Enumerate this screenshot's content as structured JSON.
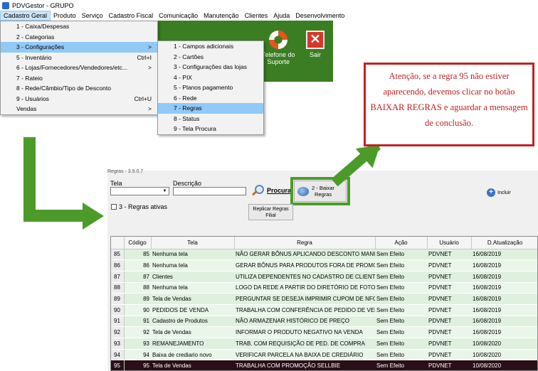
{
  "window": {
    "title": "PDVGestor - GRUPO"
  },
  "menubar": [
    "Cadastro Geral",
    "Produto",
    "Serviço",
    "Cadastro Fiscal",
    "Comunicação",
    "Manutenção",
    "Clientes",
    "Ajuda",
    "Desenvolvimento"
  ],
  "main_menu": [
    {
      "label": "1 - Caixa/Despesas",
      "shortcut": "",
      "arrow": false
    },
    {
      "label": "2 - Categorias",
      "shortcut": "",
      "arrow": false
    },
    {
      "label": "3 - Configurações",
      "shortcut": "",
      "arrow": true,
      "selected": true
    },
    {
      "label": "5 - Inventário",
      "shortcut": "Ctrl+I",
      "arrow": false
    },
    {
      "label": "6 - Lojas/Fornecedores/Vendedores/etc...",
      "shortcut": "",
      "arrow": true
    },
    {
      "label": "7 - Rateio",
      "shortcut": "",
      "arrow": false
    },
    {
      "label": "8 - Rede/Câmbio/Tipo de Desconto",
      "shortcut": "",
      "arrow": false
    },
    {
      "label": "9 - Usuários",
      "shortcut": "Ctrl+U",
      "arrow": false
    },
    {
      "label": "Vendas",
      "shortcut": "",
      "arrow": true
    }
  ],
  "sub_menu": [
    {
      "label": "1 - Campos adicionais"
    },
    {
      "label": "2 - Cartões"
    },
    {
      "label": "3 - Configurações das lojas"
    },
    {
      "label": "4 - PIX"
    },
    {
      "label": "5 - Planos pagamento"
    },
    {
      "label": "6 - Rede"
    },
    {
      "label": "7 - Regras",
      "selected": true
    },
    {
      "label": "8 - Status"
    },
    {
      "label": "9 - Tela Procura"
    }
  ],
  "arrow_glyph": ">",
  "toolbar": {
    "support_line1": "Telefone do",
    "support_line2": "Suporte",
    "exit_label": "Sair",
    "exit_glyph": "✕"
  },
  "callout": {
    "text": "Atenção, se a regra 95 não estiver aparecendo, devemos clicar no botão BAIXAR REGRAS e aguardar a mensagem de conclusão."
  },
  "form": {
    "caption": "Regras - 3.9.0.7",
    "tela_label": "Tela",
    "descricao_label": "Descrição",
    "procurar_label": "Procurar",
    "baixar_line1": "2 - Baixar",
    "baixar_line2": "Regras",
    "incluir_label": "Incluir",
    "regras_ativas_label": "3 - Regras ativas",
    "replicar_line1": "Replicar Regras",
    "replicar_line2": "Filial"
  },
  "grid": {
    "columns": [
      "",
      "Código",
      "Tela",
      "Regra",
      "Ação",
      "Usuário",
      "D.Atualização"
    ],
    "rows": [
      [
        "85",
        "85",
        "Nenhuma tela",
        "NÃO GERAR BÔNUS APLICANDO DESCONTO MANUAL",
        "Sem Efeito",
        "PDVNET",
        "16/08/2019"
      ],
      [
        "86",
        "86",
        "Nenhuma tela",
        "GERAR BÔNUS PARA PRODUTOS FORA DE PROMOÇÃO",
        "Sem Efeito",
        "PDVNET",
        "16/08/2019"
      ],
      [
        "87",
        "87",
        "Clientes",
        "UTILIZA DEPENDENTES NO CADASTRO DE CLIENTE",
        "Sem Efeito",
        "PDVNET",
        "16/08/2019"
      ],
      [
        "88",
        "88",
        "Nenhuma tela",
        "LOGO DA REDE A PARTIR DO DIRETÓRIO DE FOTOS",
        "Sem Efeito",
        "PDVNET",
        "16/08/2019"
      ],
      [
        "89",
        "89",
        "Tela de Vendas",
        "PERGUNTAR SE DESEJA IMPRIMIR CUPOM DE NFC-E",
        "Sem Efeito",
        "PDVNET",
        "16/08/2019"
      ],
      [
        "90",
        "90",
        "PEDIDOS DE VENDA",
        "TRABALHA COM CONFERÊNCIA DE PEDIDO DE VENDA",
        "Sem Efeito",
        "PDVNET",
        "16/08/2019"
      ],
      [
        "91",
        "91",
        "Cadastro de Produtos",
        "NÃO ARMAZENAR HISTÓRICO DE PREÇO",
        "Sem Efeito",
        "PDVNET",
        "16/08/2019"
      ],
      [
        "92",
        "92",
        "Tela de Vendas",
        "INFORMAR O PRODUTO NEGATIVO NA VENDA",
        "Sem Efeito",
        "PDVNET",
        "16/08/2019"
      ],
      [
        "93",
        "93",
        "REMANEJAMENTO",
        "TRAB. COM REQUISIÇÃO DE PED. DE COMPRA",
        "Sem Efeito",
        "PDVNET",
        "10/08/2020"
      ],
      [
        "94",
        "94",
        "Baixa de crediario novo",
        "VERIFICAR PARCELA NA BAIXA DE CREDIÁRIO",
        "Sem Efeito",
        "PDVNET",
        "10/08/2020"
      ],
      [
        "95",
        "95",
        "Tela de Vendas",
        "TRABALHA COM PROMOÇÃO SELLBIE",
        "Sem Efeito",
        "PDVNET",
        "10/08/2020"
      ]
    ],
    "selected_row": 10
  },
  "colors": {
    "accent_green": "#4c9b2a",
    "toolbar_green": "#3b7d22",
    "callout_red": "#c42020",
    "selected_row": "#2a0f18"
  }
}
